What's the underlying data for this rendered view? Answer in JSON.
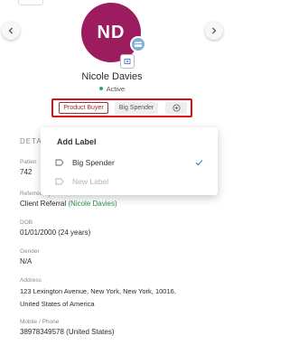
{
  "profile": {
    "initials": "ND",
    "name": "Nicole Davies",
    "status": "Active"
  },
  "labels": {
    "chips": [
      "Product Buyer",
      "Big Spender"
    ]
  },
  "details": {
    "heading": "DETA",
    "patient_label": "Patien",
    "patient_value": "742",
    "referred_label": "Referred By",
    "referred_value": "Client Referral",
    "referred_name": "(Nicole Davies)",
    "dob_label": "DOB",
    "dob_value": "01/01/2000 (24 years)",
    "gender_label": "Gender",
    "gender_value": "N/A",
    "address_label": "Address",
    "address_line1": "123 Lexington Avenue, New York, New York, 10016,",
    "address_line2": "United States of America",
    "phone_label": "Mobile / Phone",
    "phone_value": "38978349578 (United States)"
  },
  "dropdown": {
    "title": "Add Label",
    "items": [
      {
        "label": "Big Spender",
        "checked": true
      },
      {
        "label": "New Label",
        "checked": false
      }
    ]
  },
  "colors": {
    "avatar": "#9c1c5f",
    "highlight_border": "#d7101a",
    "active_dot": "#39a55a",
    "check": "#4a7fd4"
  }
}
